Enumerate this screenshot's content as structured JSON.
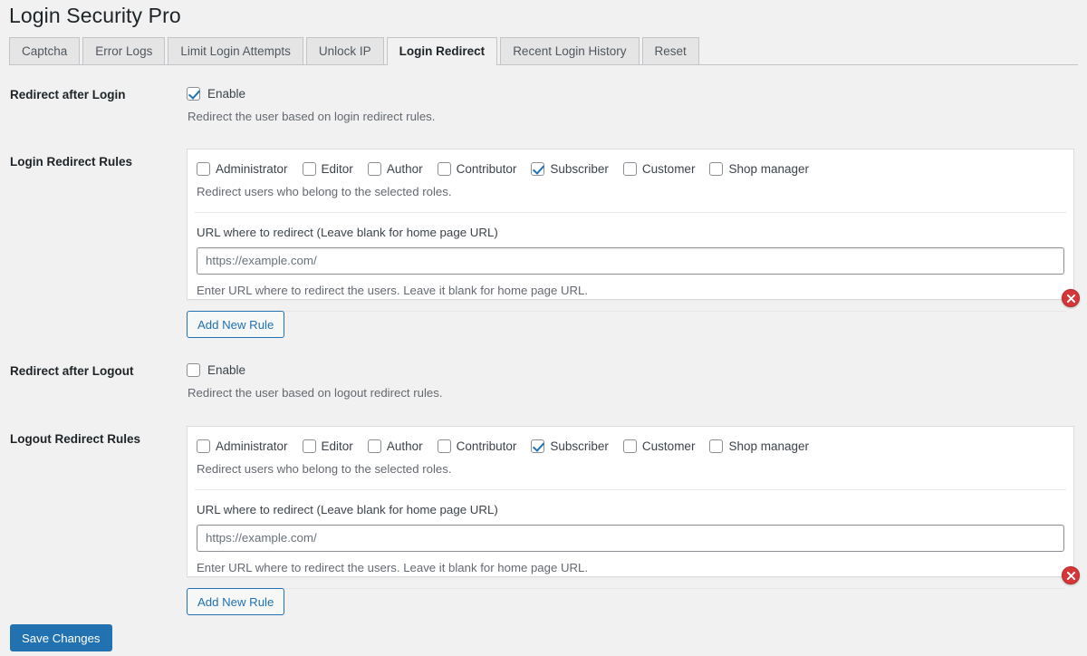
{
  "header": {
    "title": "Login Security Pro"
  },
  "tabs": [
    {
      "label": "Captcha",
      "active": false
    },
    {
      "label": "Error Logs",
      "active": false
    },
    {
      "label": "Limit Login Attempts",
      "active": false
    },
    {
      "label": "Unlock IP",
      "active": false
    },
    {
      "label": "Login Redirect",
      "active": true
    },
    {
      "label": "Recent Login History",
      "active": false
    },
    {
      "label": "Reset",
      "active": false
    }
  ],
  "login_section": {
    "row_label": "Redirect after Login",
    "enable_label": "Enable",
    "enable_checked": true,
    "enable_help": "Redirect the user based on login redirect rules.",
    "rules_row_label": "Login Redirect Rules",
    "roles": [
      {
        "label": "Administrator",
        "checked": false
      },
      {
        "label": "Editor",
        "checked": false
      },
      {
        "label": "Author",
        "checked": false
      },
      {
        "label": "Contributor",
        "checked": false
      },
      {
        "label": "Subscriber",
        "checked": true
      },
      {
        "label": "Customer",
        "checked": false
      },
      {
        "label": "Shop manager",
        "checked": false
      }
    ],
    "roles_help": "Redirect users who belong to the selected roles.",
    "url_caption": "URL where to redirect (Leave blank for home page URL)",
    "url_value": "",
    "url_placeholder": "https://example.com/",
    "url_help": "Enter URL where to redirect the users. Leave it blank for home page URL.",
    "delete_icon": "remove-circle-icon",
    "add_rule_label": "Add New Rule"
  },
  "logout_section": {
    "row_label": "Redirect after Logout",
    "enable_label": "Enable",
    "enable_checked": false,
    "enable_help": "Redirect the user based on logout redirect rules.",
    "rules_row_label": "Logout Redirect Rules",
    "roles": [
      {
        "label": "Administrator",
        "checked": false
      },
      {
        "label": "Editor",
        "checked": false
      },
      {
        "label": "Author",
        "checked": false
      },
      {
        "label": "Contributor",
        "checked": false
      },
      {
        "label": "Subscriber",
        "checked": true
      },
      {
        "label": "Customer",
        "checked": false
      },
      {
        "label": "Shop manager",
        "checked": false
      }
    ],
    "roles_help": "Redirect users who belong to the selected roles.",
    "url_caption": "URL where to redirect (Leave blank for home page URL)",
    "url_value": "",
    "url_placeholder": "https://example.com/",
    "url_help": "Enter URL where to redirect the users. Leave it blank for home page URL.",
    "delete_icon": "remove-circle-icon",
    "add_rule_label": "Add New Rule"
  },
  "footer": {
    "save_label": "Save Changes"
  },
  "colors": {
    "accent": "#2271b1",
    "danger": "#d63638",
    "page_bg": "#f1f1f1",
    "panel_bg": "#ffffff",
    "border": "#dcdcde"
  }
}
